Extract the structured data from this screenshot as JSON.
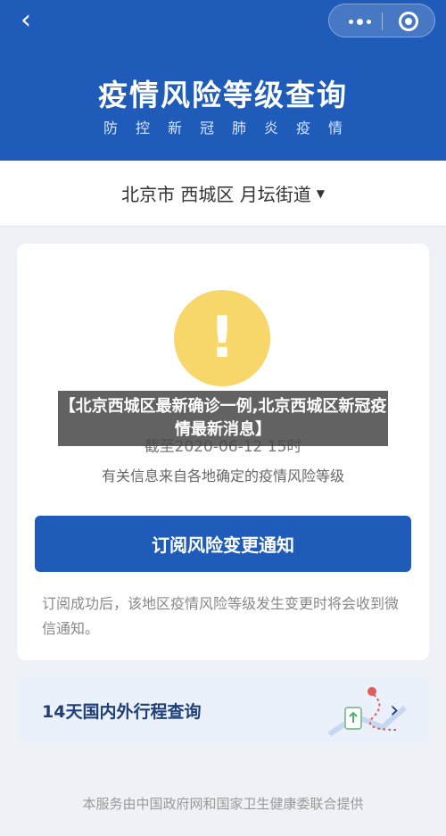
{
  "header": {
    "back_glyph": "‹",
    "title": "疫情风险等级查询",
    "subtitle": "防控新冠肺炎疫情",
    "icons": [
      "back-icon",
      "more-icon",
      "target-icon"
    ]
  },
  "region": {
    "selected": "北京市 西城区 月坛街道",
    "caret": "▼"
  },
  "status": {
    "icon_glyph": "!",
    "as_of": "截至2020-06-12 15时",
    "source": "有关信息来自各地确定的疫情风险等级",
    "level_color": "#f7d66a"
  },
  "subscribe": {
    "button_label": "订阅风险变更通知",
    "note": "订阅成功后，该地区疫情风险等级发生变更时将会收到微信通知。"
  },
  "overlay": {
    "text": "【北京西城区最新确诊一例,北京西城区新冠疫情最新消息】"
  },
  "itinerary": {
    "label": "14天国内外行程查询",
    "chevron": "›"
  },
  "footer": {
    "text": "本服务由中国政府网和国家卫生健康委联合提供"
  },
  "colors": {
    "primary": "#1f5bb8",
    "warning": "#f7d66a"
  }
}
